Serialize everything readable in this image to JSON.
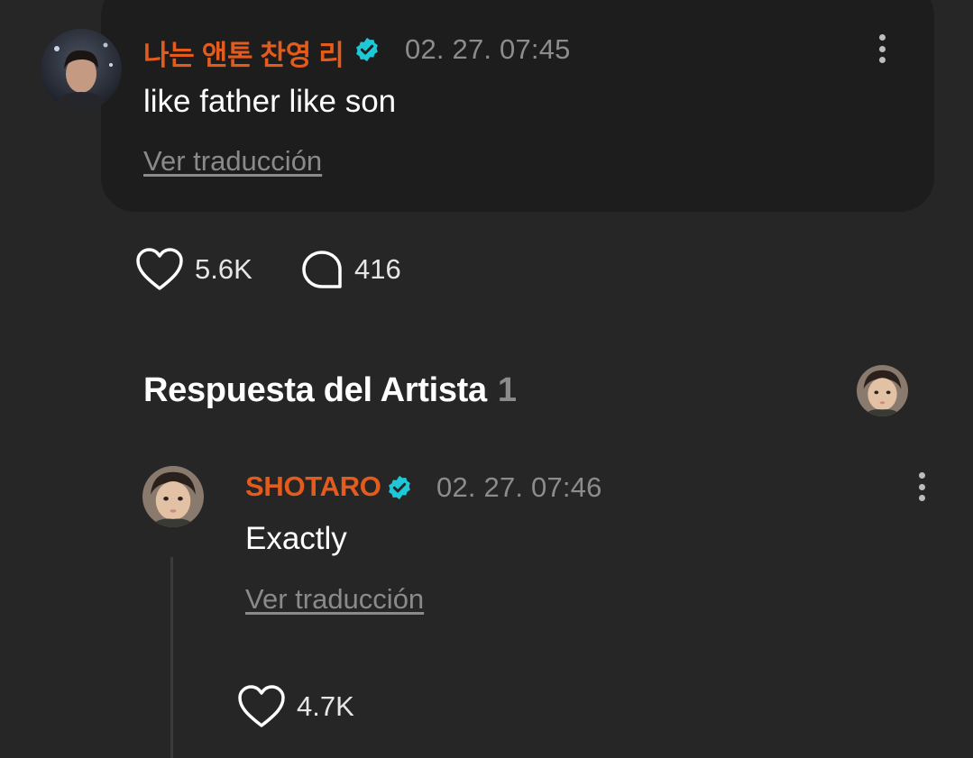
{
  "comment": {
    "author": "나는 앤톤 찬영 리",
    "timestamp": "02. 27. 07:45",
    "text": "like father like son",
    "translate_label": "Ver traducción",
    "likes": "5.6K",
    "replies": "416"
  },
  "artist_section": {
    "title": "Respuesta del Artista",
    "count": "1"
  },
  "reply": {
    "author": "SHOTARO",
    "timestamp": "02. 27. 07:46",
    "text": "Exactly",
    "translate_label": "Ver traducción",
    "likes": "4.7K"
  },
  "colors": {
    "background": "#262626",
    "card": "#1d1d1d",
    "author": "#e35b1d",
    "verified": "#1ec8d6",
    "muted": "#8c8c8c"
  },
  "icons": {
    "verified": "verified-badge-icon",
    "like": "heart-icon",
    "reply": "speech-bubble-icon",
    "more": "more-vertical-icon"
  }
}
